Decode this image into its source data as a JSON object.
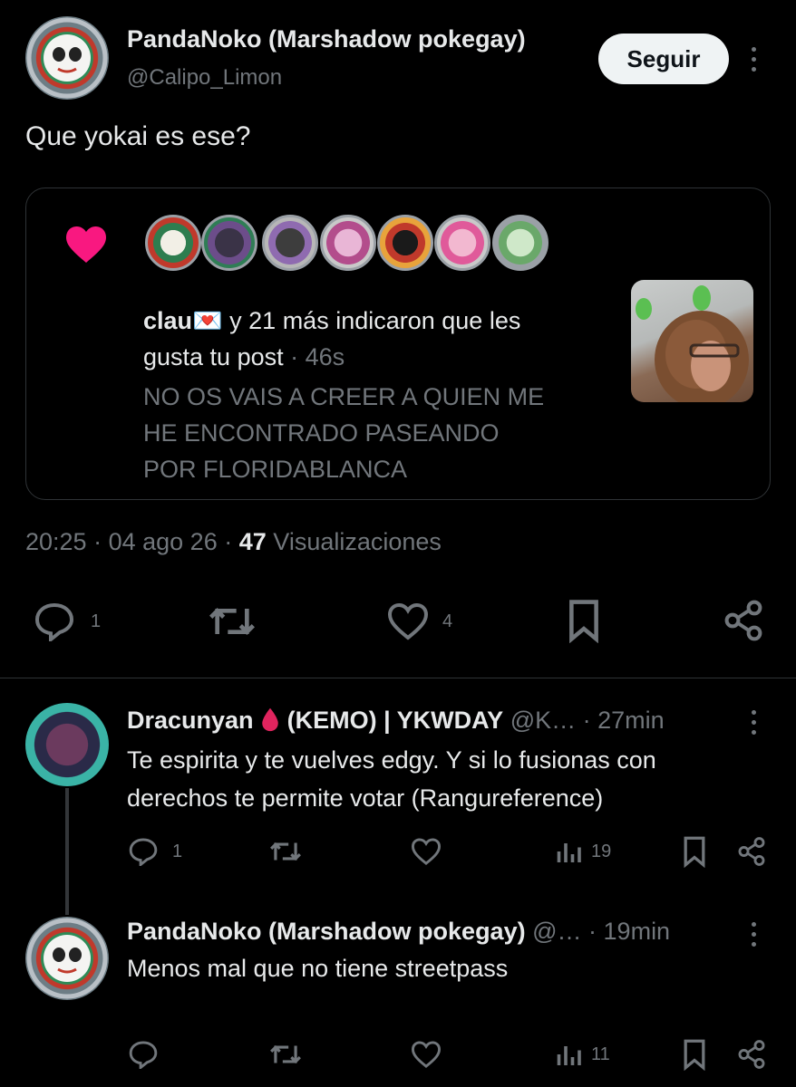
{
  "main_post": {
    "author_name": "PandaNoko (Marshadow pokegay)",
    "author_handle": "@Calipo_Limon",
    "follow_label": "Seguir",
    "text": "Que yokai es ese?",
    "quoted_notification": {
      "user": "clau💌",
      "summary": " y 21 más indicaron que les",
      "summary_line2": "gusta tu post",
      "time": " · 46s",
      "quoted_text_line1": "NO OS VAIS A CREER A QUIEN ME",
      "quoted_text_line2": "HE ENCONTRADO PASEANDO",
      "quoted_text_line3": "POR FLORIDABLANCA"
    },
    "meta": {
      "time": "20:25",
      "date": "04 ago 26",
      "views_count": "47",
      "views_label": "Visualizaciones"
    },
    "actions": {
      "replies": "1",
      "likes": "4"
    }
  },
  "replies": [
    {
      "author_name": "Dracunyan",
      "author_suffix": "(KEMO) | YKWDAY",
      "author_handle": "@K…",
      "time": "· 27min",
      "text_line1": "Te espirita y te vuelves edgy. Y si lo fusionas con",
      "text_line2": "derechos te permite votar (Rangureference)",
      "replies": "1",
      "views": "19"
    },
    {
      "author_name": "PandaNoko (Marshadow pokegay)",
      "author_handle": "@…",
      "time": "· 19min",
      "text_line1": "Menos mal que no tiene streetpass",
      "views": "11"
    }
  ],
  "colors": {
    "background": "#000000",
    "text": "#e7e9ea",
    "muted": "#71767b",
    "heart_pink": "#f91880",
    "blood_red": "#e0245e"
  }
}
